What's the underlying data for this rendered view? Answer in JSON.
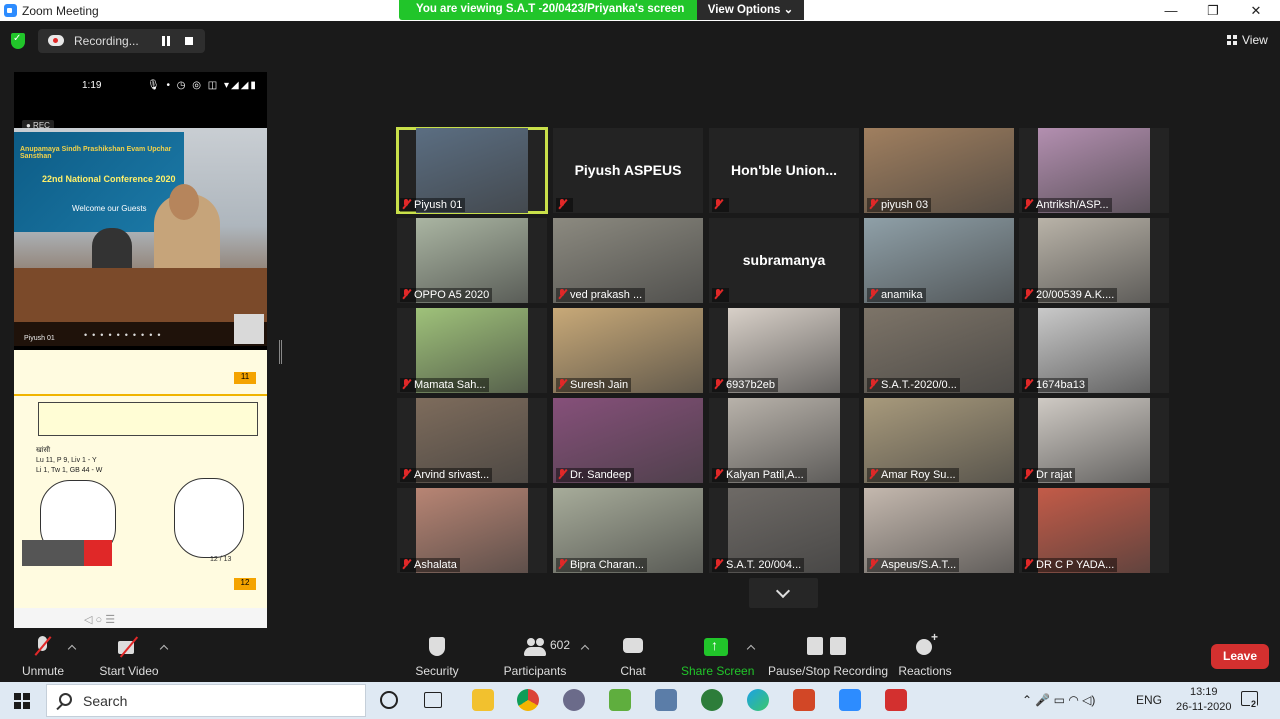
{
  "window": {
    "title": "Zoom Meeting",
    "banner": "You are viewing S.A.T -20/0423/Priyanka's screen",
    "view_options": "View Options ⌄",
    "minimize": "—",
    "maximize": "❐",
    "close": "✕"
  },
  "top_bar": {
    "recording_label": "Recording...",
    "view_label": "View"
  },
  "shared_screen": {
    "time": "1:19",
    "status_icons": "🎙 • ◷ ◎ ◫ ▾◢◢▮",
    "rec_badge": "● REC",
    "board_line1": "Anupamaya Sindh Prashikshan Evam Upchar Sansthan",
    "board_line2": "22nd National Conference 2020",
    "board_line3": "Welcome our Guests",
    "speaker_name": "Piyush 01",
    "doc_page_1": "11",
    "doc_page_2": "12",
    "doc_note": "खांसी\nLu 11, P 9, Liv 1 - Y\nLi 1, Tw 1, GB 44 - W",
    "page_counter": "12 / 13",
    "nav_buttons": "◁     ○     ☰"
  },
  "gallery": {
    "tiles": [
      {
        "name": "Piyush 01",
        "muted": true,
        "active": true,
        "color": "#5b6e82"
      },
      {
        "name": "Piyush ASPEUS",
        "muted": true,
        "video": false
      },
      {
        "name": "Hon'ble  Union...",
        "muted": true,
        "video": false
      },
      {
        "name": "piyush 03",
        "muted": true,
        "color": "#a07f5f"
      },
      {
        "name": "Antriksh/ASP...",
        "muted": true,
        "color": "#b38fb0"
      },
      {
        "name": "OPPO A5 2020",
        "muted": true,
        "color": "#aab5a2"
      },
      {
        "name": "ved prakash ...",
        "muted": true,
        "color": "#8c8a80"
      },
      {
        "name": "subramanya",
        "muted": true,
        "video": false
      },
      {
        "name": "anamika",
        "muted": true,
        "color": "#8fa0a8"
      },
      {
        "name": "20/00539 A.K....",
        "muted": true,
        "color": "#b9b3a8"
      },
      {
        "name": "Mamata Sah...",
        "muted": true,
        "color": "#9fc27a"
      },
      {
        "name": "Suresh Jain",
        "muted": true,
        "color": "#c8a978"
      },
      {
        "name": "6937b2eb",
        "muted": true,
        "color": "#d8d0c8"
      },
      {
        "name": "S.A.T.-2020/0...",
        "muted": true,
        "color": "#7d7468"
      },
      {
        "name": "1674ba13",
        "muted": true,
        "color": "#c9c9c9"
      },
      {
        "name": "Arvind srivast...",
        "muted": true,
        "color": "#7e6c5c"
      },
      {
        "name": "Dr. Sandeep",
        "muted": true,
        "color": "#86507a"
      },
      {
        "name": "Kalyan Patil,A...",
        "muted": true,
        "color": "#b8b2aa"
      },
      {
        "name": "Amar Roy Su...",
        "muted": true,
        "color": "#a89a7c"
      },
      {
        "name": "Dr rajat",
        "muted": true,
        "color": "#cfcac4"
      },
      {
        "name": "Ashalata",
        "muted": true,
        "color": "#b88574"
      },
      {
        "name": "Bipra Charan...",
        "muted": true,
        "color": "#a7ac9a"
      },
      {
        "name": "S.A.T. 20/004...",
        "muted": true,
        "color": "#6e6a66"
      },
      {
        "name": "Aspeus/S.A.T...",
        "muted": true,
        "color": "#c4b8ae"
      },
      {
        "name": "DR C P YADA...",
        "muted": true,
        "color": "#c35b48"
      }
    ]
  },
  "toolbar": {
    "unmute": "Unmute",
    "start_video": "Start Video",
    "security": "Security",
    "participants": "Participants",
    "participants_count": "602",
    "chat": "Chat",
    "share_screen": "Share Screen",
    "pause_stop_recording": "Pause/Stop Recording",
    "reactions": "Reactions",
    "leave": "Leave"
  },
  "taskbar": {
    "search_placeholder": "Search",
    "language": "ENG",
    "time": "13:19",
    "date": "26-11-2020",
    "notifications": "2",
    "tray_icons": "⌃  🎤  ▭  ◠  ◁)"
  },
  "colors": {
    "banner_green": "#21c52a",
    "leave_red": "#d3302f",
    "active_speaker": "#c9e04a",
    "share_green": "#21c52a",
    "muted_red": "#e02828"
  }
}
